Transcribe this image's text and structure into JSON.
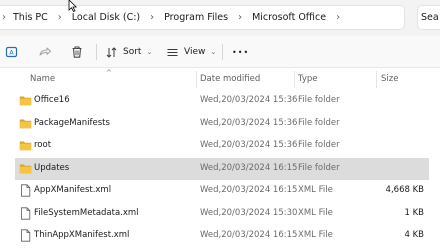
{
  "breadcrumb": {
    "items": [
      "This PC",
      "Local Disk (C:)",
      "Program Files",
      "Microsoft Office"
    ],
    "search_text": "Sea"
  },
  "toolbar": {
    "sort_label": "Sort",
    "view_label": "View",
    "more_label": "•••"
  },
  "columns": {
    "name": "Name",
    "date_modified": "Date modified",
    "type": "Type",
    "size": "Size"
  },
  "files": [
    {
      "name": "Office16",
      "date": "Wed,20/03/2024 15:36",
      "type": "File folder",
      "size": "",
      "icon": "folder-icon",
      "selected": false
    },
    {
      "name": "PackageManifests",
      "date": "Wed,20/03/2024 15:36",
      "type": "File folder",
      "size": "",
      "icon": "folder-icon",
      "selected": false
    },
    {
      "name": "root",
      "date": "Wed,20/03/2024 15:36",
      "type": "File folder",
      "size": "",
      "icon": "folder-icon",
      "selected": false
    },
    {
      "name": "Updates",
      "date": "Wed,20/03/2024 16:15",
      "type": "File folder",
      "size": "",
      "icon": "folder-icon",
      "selected": true
    },
    {
      "name": "AppXManifest.xml",
      "date": "Wed,20/03/2024 16:15",
      "type": "XML File",
      "size": "4,668 KB",
      "icon": "file-icon",
      "selected": false
    },
    {
      "name": "FileSystemMetadata.xml",
      "date": "Wed,20/03/2024 15:30",
      "type": "XML File",
      "size": "1 KB",
      "icon": "file-icon",
      "selected": false
    },
    {
      "name": "ThinAppXManifest.xml",
      "date": "Wed,20/03/2024 16:15",
      "type": "XML File",
      "size": "4 KB",
      "icon": "file-icon",
      "selected": false
    }
  ],
  "colors": {
    "folder": "#f4c542",
    "folder_dark": "#dca425",
    "accent_icon": "#1f6fc5",
    "selected_row": "#dcdcdc"
  }
}
